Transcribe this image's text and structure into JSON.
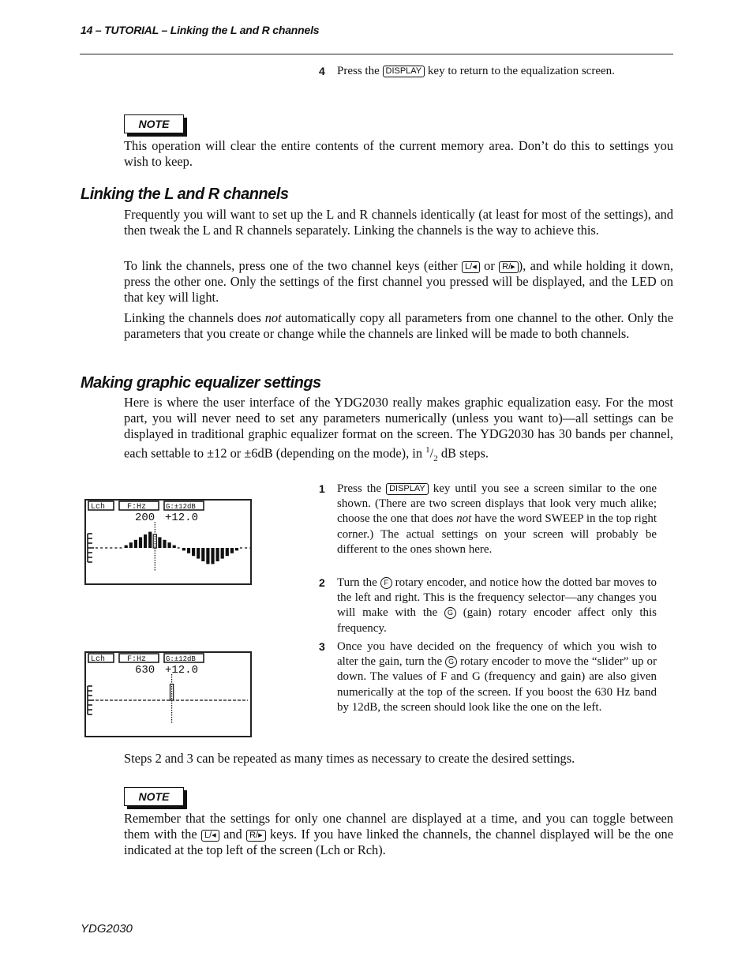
{
  "header": {
    "running_title": "14 – TUTORIAL – Linking the L and R channels"
  },
  "step4": {
    "number": "4",
    "pre": "Press the",
    "key": "DISPLAY",
    "post": "key to return to the equalization screen."
  },
  "note1": {
    "label": "NOTE",
    "text": "This operation will clear the entire contents of the current memory area. Don’t do this to settings you wish to keep."
  },
  "linking": {
    "heading": "Linking the L and R channels",
    "p1": "Frequently you will want to set up the L and R channels identically (at least for most of the settings), and then tweak the L and R channels separately. Linking the channels is the way to achieve this.",
    "p2_a": "To link the channels, press one of the two channel keys (either",
    "key_l": "L/◂",
    "p2_or": "or",
    "key_r": "R/▸",
    "p2_b": "), and while holding it down, press the other one. Only the settings of the first channel you pressed will be displayed, and the LED on that key will light.",
    "p3_a": "Linking the channels does",
    "p3_em": "not",
    "p3_b": "automatically copy all parameters from one channel to the other. Only the parameters that you create or change while the channels are linked will be made to both channels."
  },
  "geq": {
    "heading": "Making graphic equalizer settings",
    "p1": "Here is where the user interface of the YDG2030 really makes graphic equalization easy. For the most part, you will never need to set any parameters numerically (unless you want to)—all settings can be displayed in traditional graphic equalizer format on the screen. The YDG2030 has 30 bands per channel, each settable to ±12 or ±6dB (depending on the mode), in",
    "frac_num": "1",
    "frac_den": "2",
    "p1_end": "dB steps."
  },
  "steps": [
    {
      "number": "1",
      "a": "Press the",
      "key": "DISPLAY",
      "b": "key until you see a screen similar to the one shown. (There are two screen displays that look very much alike; choose the one that does",
      "em": "not",
      "c": "have the word SWEEP in the top right corner.) The actual settings on your screen will probably be different to the ones shown here."
    },
    {
      "number": "2",
      "a": "Turn the",
      "enc1": "F",
      "b": "rotary encoder, and notice how the dotted bar moves to the left and right. This is the frequency selector—any changes you will make with the",
      "enc2": "G",
      "c": "(gain) rotary encoder affect only this frequency."
    },
    {
      "number": "3",
      "a": "Once you have decided on the frequency of which you wish to alter the gain, turn the",
      "enc1": "G",
      "b": "rotary encoder to move the “slider” up or down. The values of F and G (frequency and gain) are also given numerically at the top of the screen. If you boost the 630 Hz band by 12dB, the screen should look like the one on the left."
    }
  ],
  "lcd1": {
    "tab_ch": "Lch",
    "tab_f": "F:Hz",
    "tab_g": "G:±12dB",
    "freq": "200",
    "gain": "+12.0",
    "bands": [
      0,
      0,
      0,
      0,
      0,
      0,
      1,
      2,
      3,
      4,
      5,
      6,
      5,
      4,
      3,
      2,
      1,
      0,
      -1,
      -2,
      -3,
      -4,
      -5,
      -6,
      -6,
      -5,
      -4,
      -3,
      -2,
      -1,
      0,
      0,
      0
    ],
    "selected_index": 12
  },
  "lcd2": {
    "tab_ch": "Lch",
    "tab_f": "F:Hz",
    "tab_g": "G:±12dB",
    "freq": "630",
    "gain": "+12.0",
    "selected_fraction": 0.5,
    "selected_level": 6
  },
  "after_steps": "Steps 2 and 3 can be repeated as many times as necessary to create the desired settings.",
  "note2": {
    "label": "NOTE",
    "a": "Remember that the settings for only one channel are displayed at a time, and you can toggle between them with the",
    "key_l": "L/◂",
    "and": "and",
    "key_r": "R/▸",
    "b": "keys. If you have linked the channels, the channel displayed will be the one indicated at the top left of the screen (Lch or Rch)."
  },
  "footer": {
    "product": "YDG2030"
  }
}
